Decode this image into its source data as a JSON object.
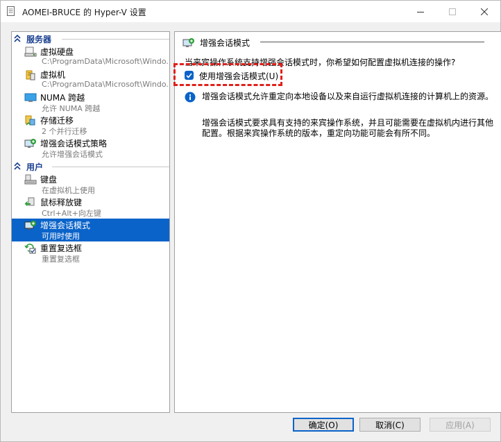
{
  "window": {
    "title": "AOMEI-BRUCE 的 Hyper-V 设置",
    "icon": "settings-document-icon",
    "controls": [
      "minimize-icon",
      "maximize-icon",
      "close-icon"
    ]
  },
  "sidebar": {
    "sections": [
      {
        "label": "服务器",
        "icon": "collapse-chevron-icon"
      },
      {
        "label": "用户",
        "icon": "collapse-chevron-icon"
      }
    ],
    "items": [
      {
        "name": "虚拟硬盘",
        "sub": "C:\\ProgramData\\Microsoft\\Windo...",
        "icon": "virtual-disk-icon"
      },
      {
        "name": "虚拟机",
        "sub": "C:\\ProgramData\\Microsoft\\Windo...",
        "icon": "virtual-machine-icon"
      },
      {
        "name": "NUMA 跨越",
        "sub": "允许 NUMA 跨越",
        "icon": "numa-monitor-icon"
      },
      {
        "name": "存储迁移",
        "sub": "2 个并行迁移",
        "icon": "storage-migration-icon"
      },
      {
        "name": "增强会话模式策略",
        "sub": "允许增强会话模式",
        "icon": "enhanced-session-policy-icon"
      },
      {
        "name": "键盘",
        "sub": "在虚拟机上使用",
        "icon": "keyboard-icon"
      },
      {
        "name": "鼠标释放键",
        "sub": "Ctrl+Alt+向左键",
        "icon": "mouse-release-icon"
      },
      {
        "name": "增强会话模式",
        "sub": "可用时使用",
        "icon": "enhanced-session-icon",
        "selected": true
      },
      {
        "name": "重置复选框",
        "sub": "重置复选框",
        "icon": "reset-checkbox-icon"
      }
    ]
  },
  "content": {
    "title": "增强会话模式",
    "question": "当来宾操作系统支持增强会话模式时，你希望如何配置虚拟机连接的操作?",
    "checkbox_label": "使用增强会话模式(U)",
    "checkbox_checked": true,
    "info_para1": "增强会话模式允许重定向本地设备以及来自运行虚拟机连接的计算机上的资源。",
    "info_para2": "增强会话模式要求具有支持的来宾操作系统，并且可能需要在虚拟机内进行其他配置。根据来宾操作系统的版本，重定向功能可能会有所不同。"
  },
  "buttons": {
    "ok": "确定(O)",
    "cancel": "取消(C)",
    "apply": "应用(A)"
  },
  "colors": {
    "selection": "#0a63c9",
    "section_header": "#1a3f8f",
    "highlight": "#e0201b"
  }
}
